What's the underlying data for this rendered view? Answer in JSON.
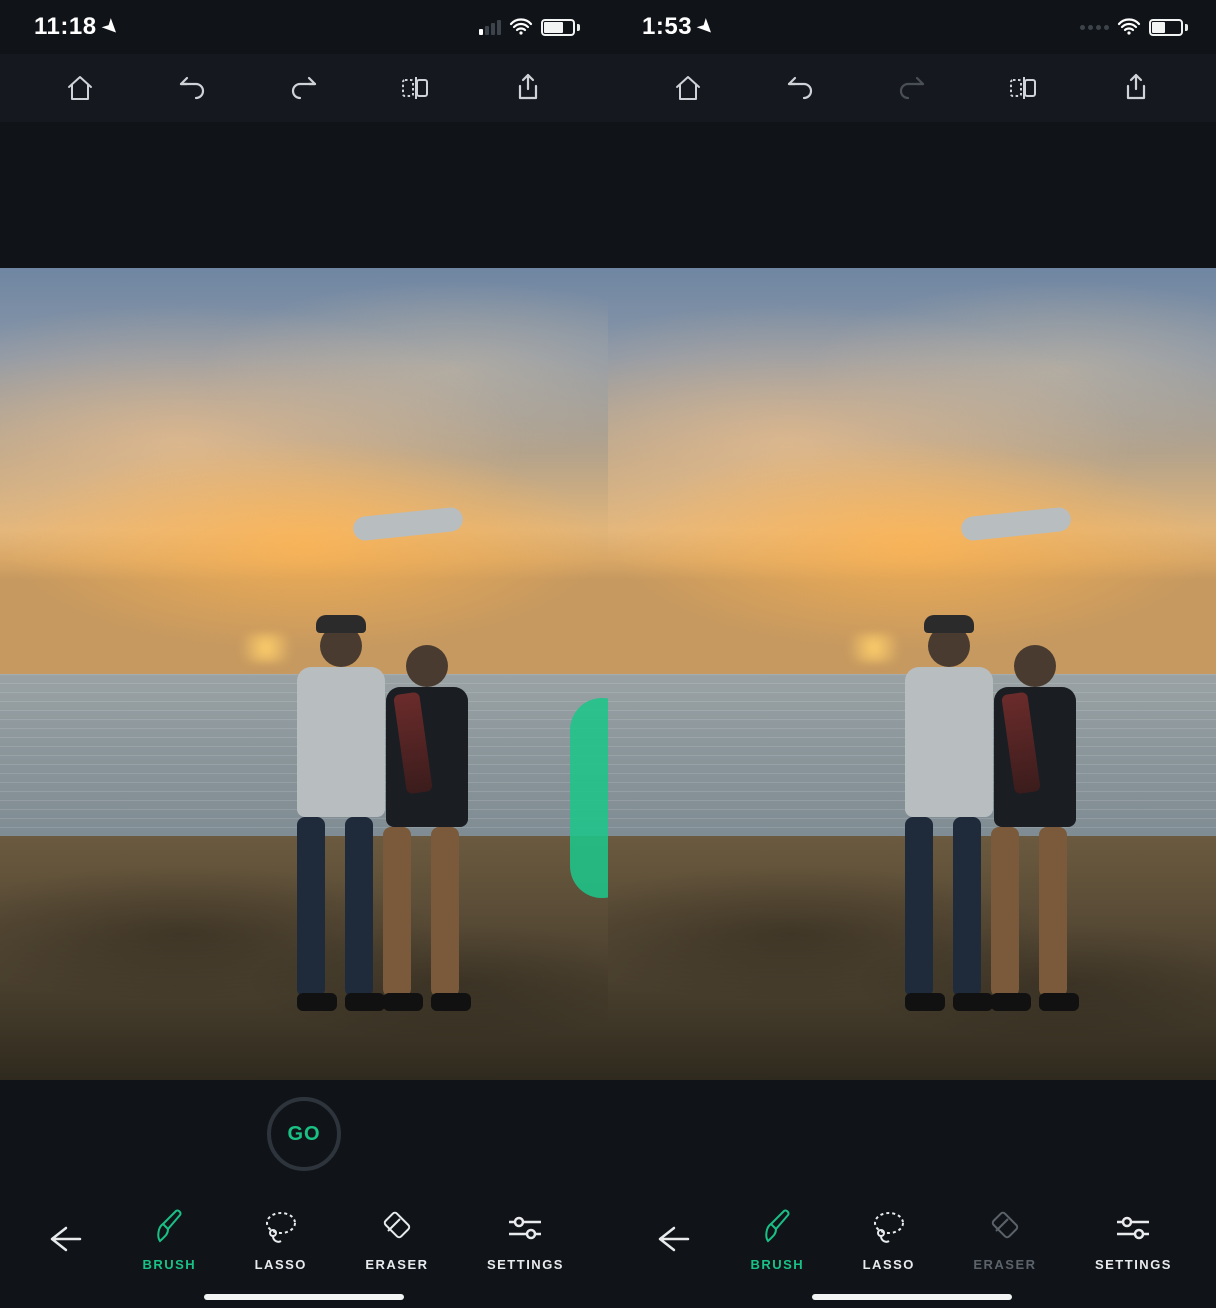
{
  "accent": "#19c184",
  "panels": [
    {
      "status": {
        "time": "11:18",
        "signal_type": "bars",
        "signal_bars_on": 1,
        "battery_pct": 62
      },
      "top_toolbar": {
        "redo_enabled": true
      },
      "canvas": {
        "has_brush_mark": true
      },
      "go": {
        "label": "GO",
        "visible": true
      },
      "bottom": {
        "back": true,
        "tools": [
          {
            "key": "brush",
            "label": "BRUSH",
            "active": true,
            "enabled": true
          },
          {
            "key": "lasso",
            "label": "LASSO",
            "active": false,
            "enabled": true
          },
          {
            "key": "eraser",
            "label": "ERASER",
            "active": false,
            "enabled": true
          },
          {
            "key": "settings",
            "label": "SETTINGS",
            "active": false,
            "enabled": true
          }
        ]
      }
    },
    {
      "status": {
        "time": "1:53",
        "signal_type": "dots",
        "signal_bars_on": 0,
        "battery_pct": 42
      },
      "top_toolbar": {
        "redo_enabled": false
      },
      "canvas": {
        "has_brush_mark": false
      },
      "go": {
        "label": "GO",
        "visible": false
      },
      "bottom": {
        "back": true,
        "tools": [
          {
            "key": "brush",
            "label": "BRUSH",
            "active": true,
            "enabled": true
          },
          {
            "key": "lasso",
            "label": "LASSO",
            "active": false,
            "enabled": true
          },
          {
            "key": "eraser",
            "label": "ERASER",
            "active": false,
            "enabled": false
          },
          {
            "key": "settings",
            "label": "SETTINGS",
            "active": false,
            "enabled": true
          }
        ]
      }
    }
  ],
  "icons": {
    "home": "home-icon",
    "undo": "undo-icon",
    "redo": "redo-icon",
    "compare": "compare-icon",
    "share": "share-icon",
    "brush": "brush-icon",
    "lasso": "lasso-icon",
    "eraser": "eraser-icon",
    "settings": "settings-icon"
  }
}
